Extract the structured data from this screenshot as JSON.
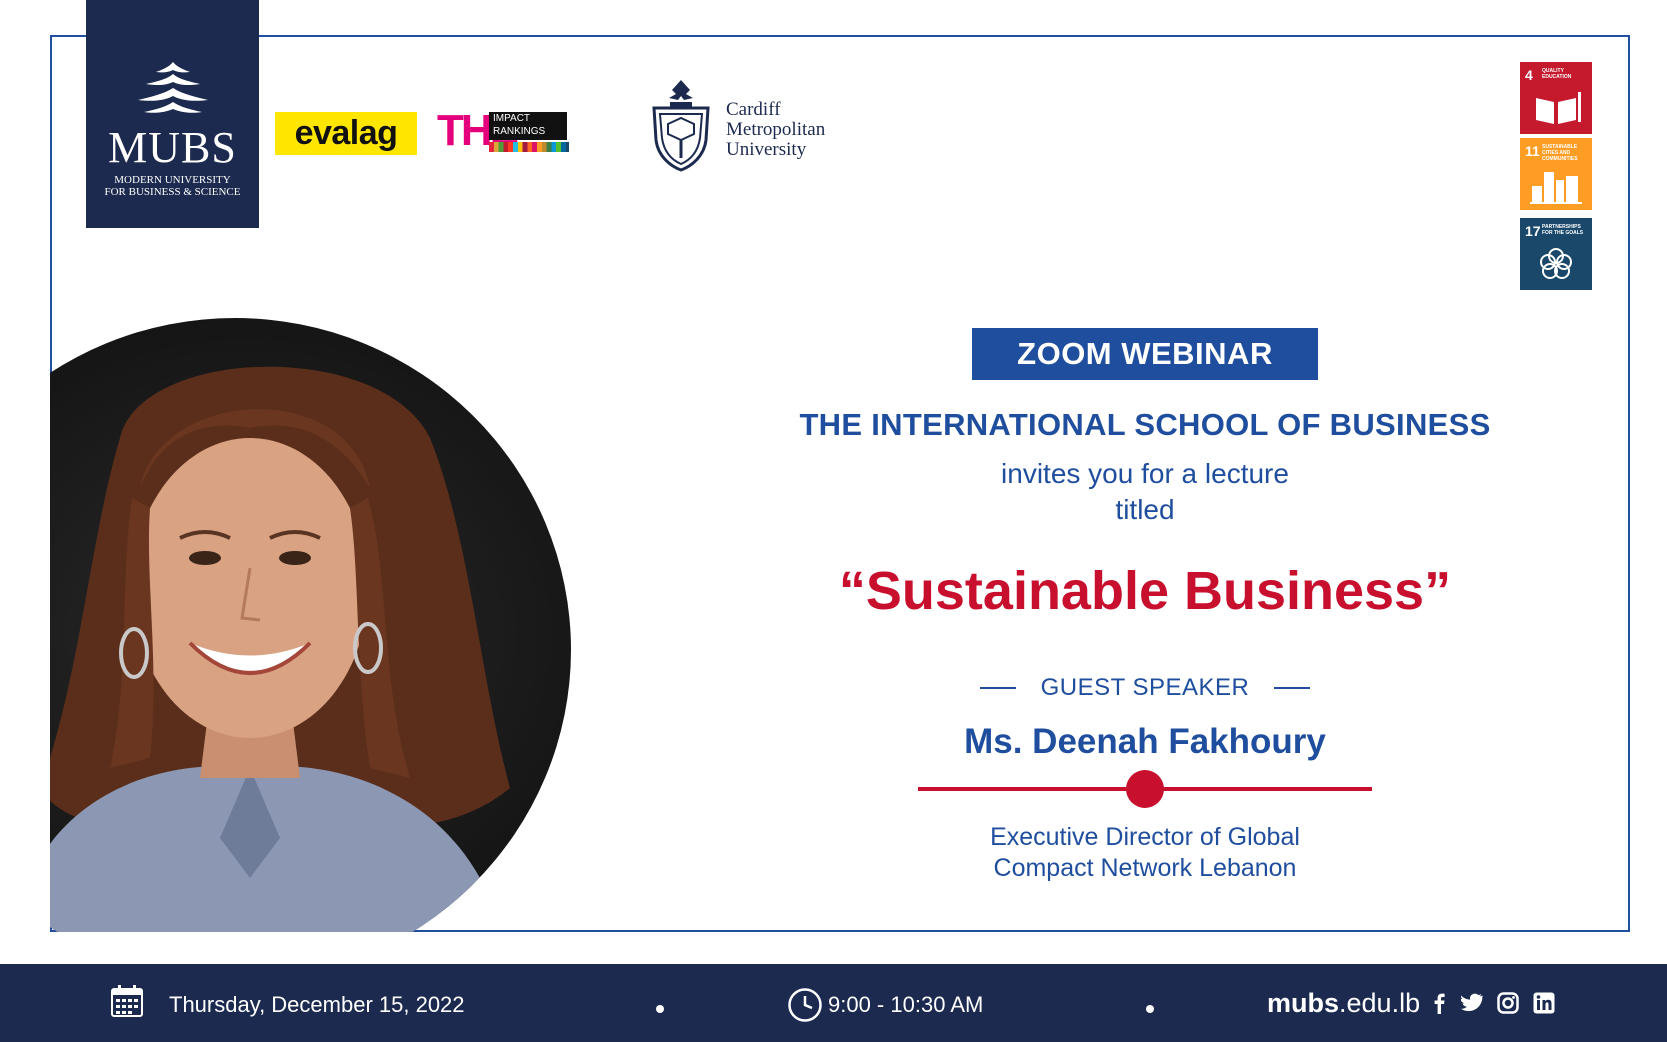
{
  "logos": {
    "mubs": {
      "name": "MUBS",
      "line1": "MODERN UNIVERSITY",
      "line2": "FOR BUSINESS & SCIENCE"
    },
    "evalag": "evalag",
    "the": {
      "mark": "THE",
      "line1": "IMPACT",
      "line2": "RANKINGS"
    },
    "cardiff": {
      "line1": "Cardiff",
      "line2": "Metropolitan",
      "line3": "University"
    }
  },
  "sdg": [
    {
      "num": "4",
      "label": "QUALITY EDUCATION",
      "color": "#c5192d",
      "icon": "book-icon"
    },
    {
      "num": "11",
      "label": "SUSTAINABLE CITIES AND COMMUNITIES",
      "color": "#fd9d24",
      "icon": "city-icon"
    },
    {
      "num": "17",
      "label": "PARTNERSHIPS FOR THE GOALS",
      "color": "#19486a",
      "icon": "partnership-icon"
    }
  ],
  "event": {
    "format": "ZOOM WEBINAR",
    "host": "THE INTERNATIONAL SCHOOL OF BUSINESS",
    "invite_line1": "invites you for a lecture",
    "invite_line2": "titled",
    "title": "“Sustainable Business”",
    "guest_label": "GUEST SPEAKER",
    "speaker": "Ms. Deenah Fakhoury",
    "role_line1": "Executive Director of Global",
    "role_line2": "Compact Network Lebanon"
  },
  "footer": {
    "date": "Thursday, December 15, 2022",
    "time": "9:00 - 10:30 AM",
    "site_bold": "mubs",
    "site_rest": ".edu.lb",
    "social": [
      "facebook-icon",
      "twitter-icon",
      "instagram-icon",
      "linkedin-icon"
    ]
  },
  "colors": {
    "navy": "#1b2a4e",
    "blue": "#1f4e9e",
    "red": "#c8102e"
  }
}
